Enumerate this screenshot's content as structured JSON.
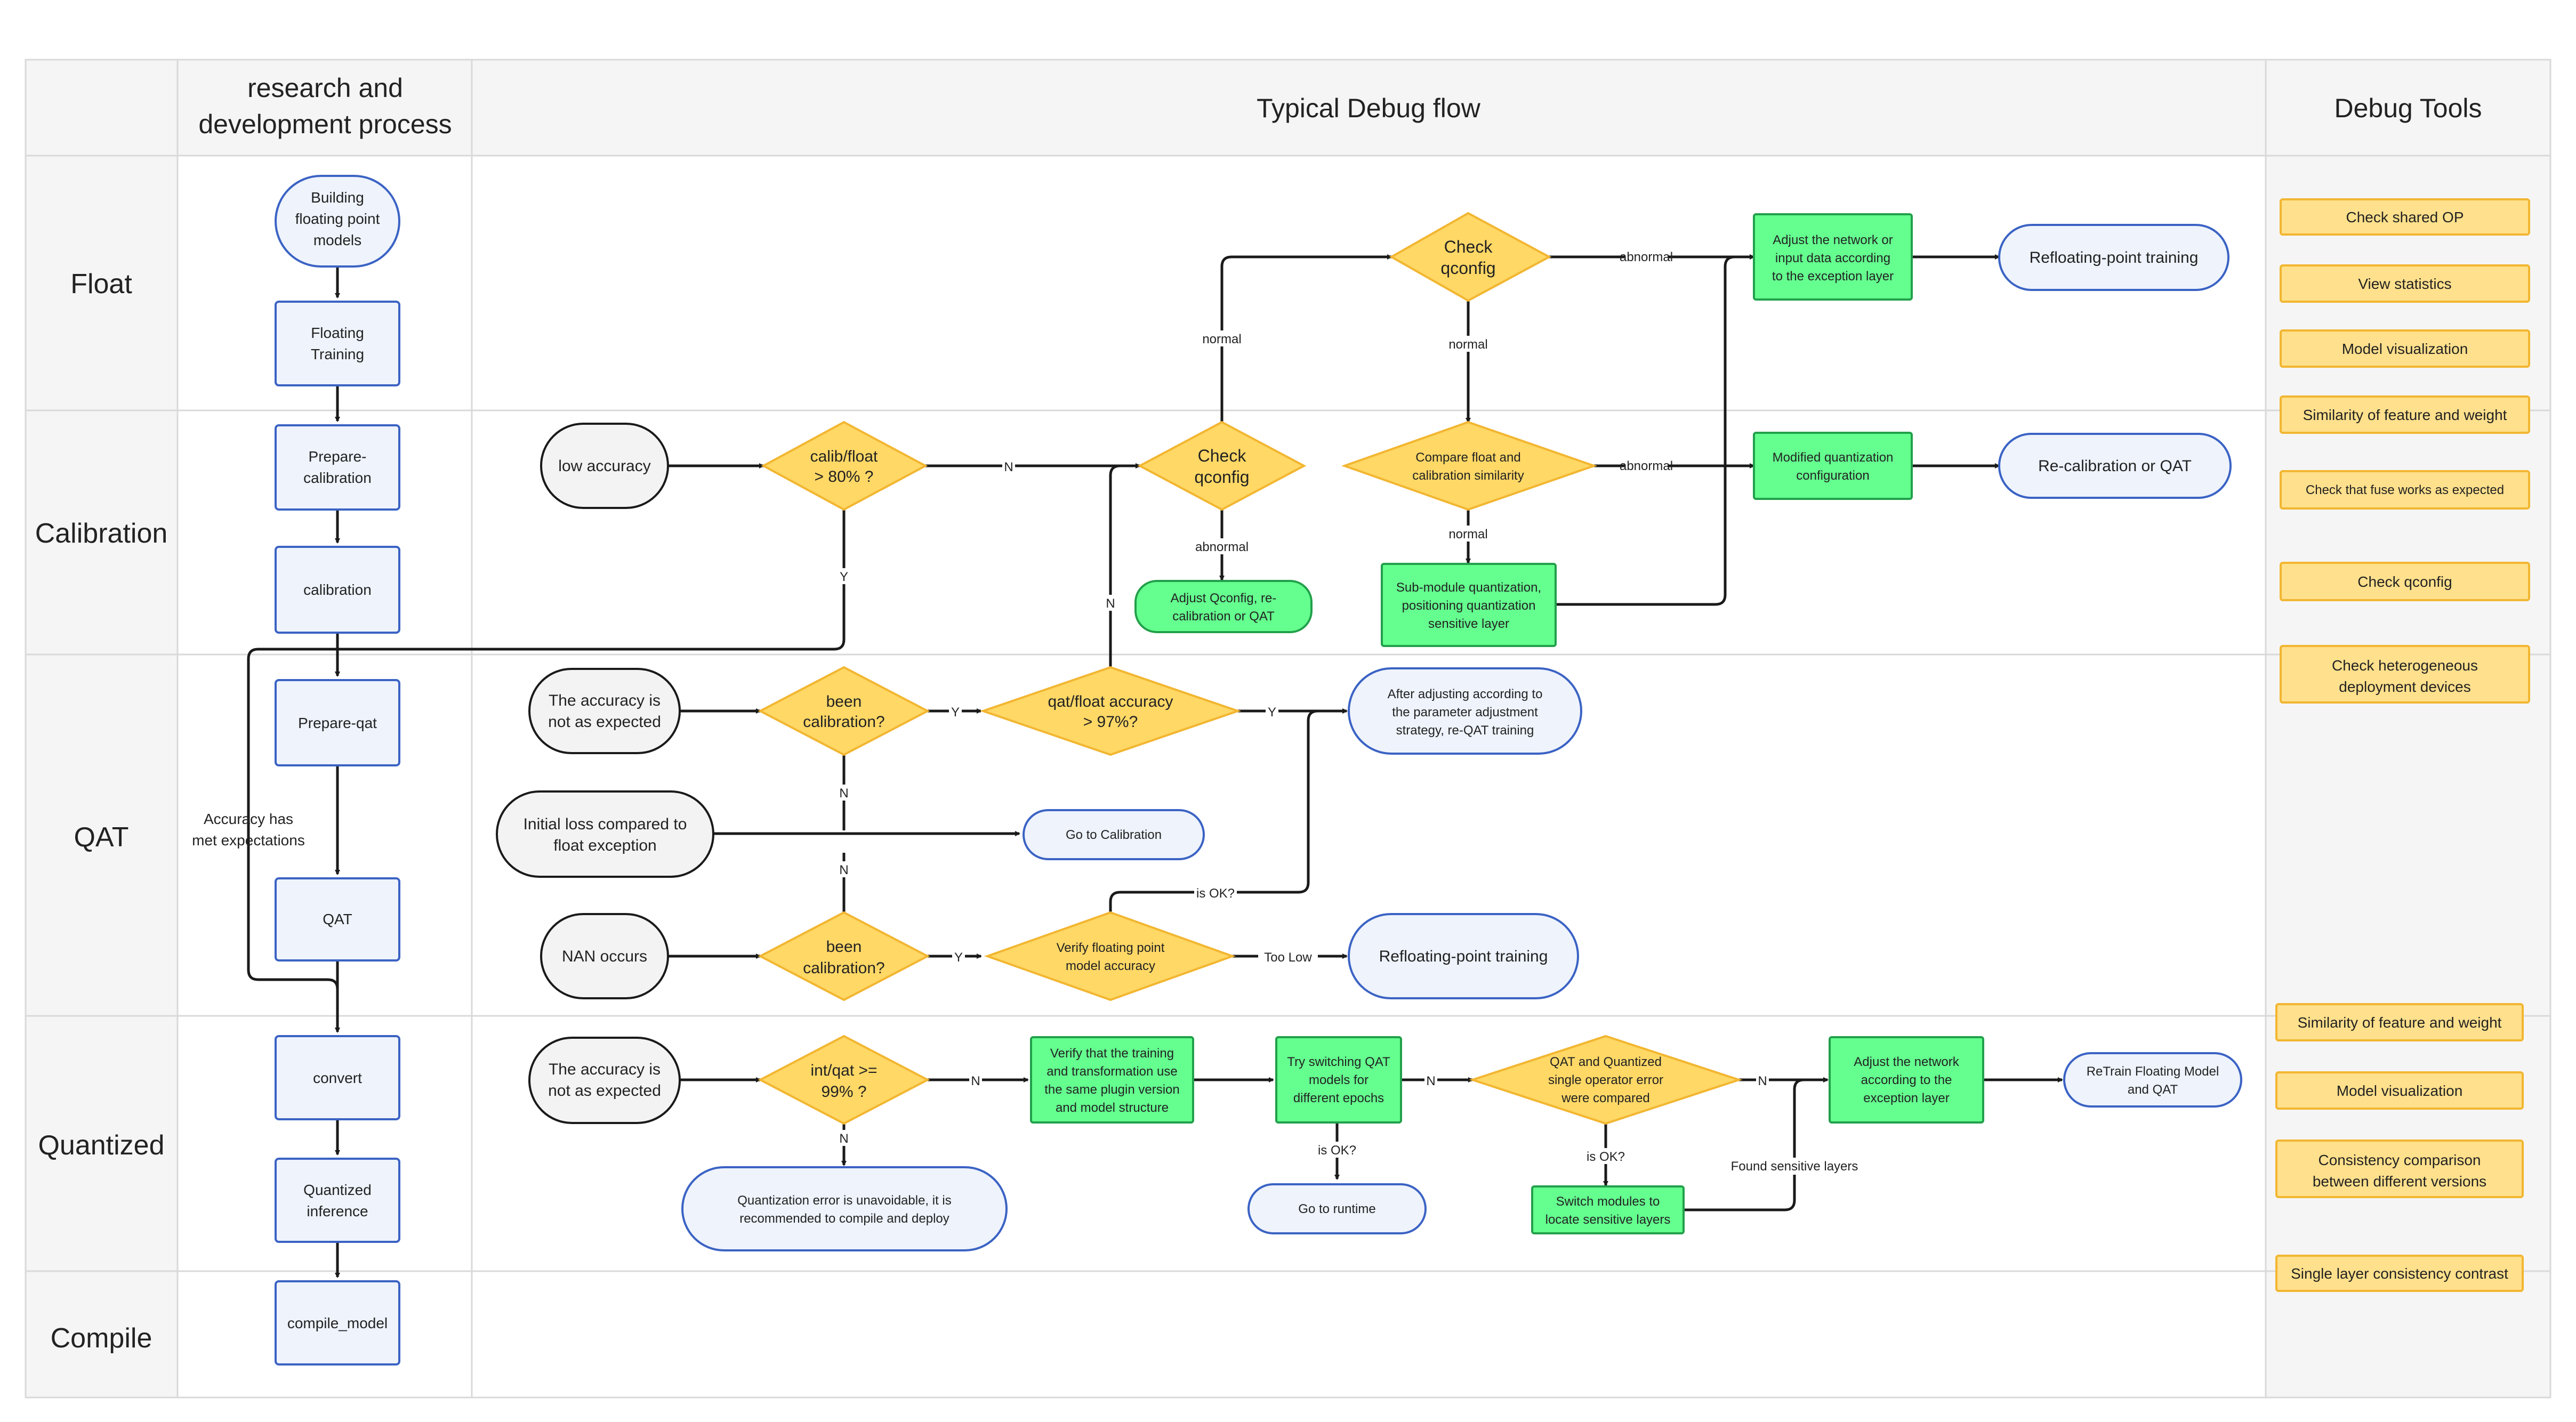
{
  "headers": {
    "process": [
      "research and",
      "development process"
    ],
    "flow": "Typical Debug flow",
    "tools": "Debug Tools"
  },
  "rows": [
    "Float",
    "Calibration",
    "QAT",
    "Quantized",
    "Compile"
  ],
  "process_steps": {
    "building": [
      "Building",
      "floating point",
      "models"
    ],
    "floating_training": [
      "Floating",
      "Training"
    ],
    "prepare_calibration": [
      "Prepare-",
      "calibration"
    ],
    "calibration": "calibration",
    "prepare_qat": "Prepare-qat",
    "qat": "QAT",
    "convert": "convert",
    "quantized_inference": [
      "Quantized",
      "inference"
    ],
    "compile_model": "compile_model"
  },
  "accuracy_met": [
    "Accuracy has",
    "met expectations"
  ],
  "calibration_flow": {
    "low_accuracy": "low accuracy",
    "calib_float": [
      "calib/float",
      "> 80% ?"
    ],
    "check_qconfig_cal": [
      "Check",
      "qconfig"
    ],
    "adjust_qconfig": [
      "Adjust Qconfig, re-",
      "calibration or QAT"
    ],
    "check_qconfig_top": [
      "Check",
      "qconfig"
    ],
    "adjust_network_top": [
      "Adjust the network or",
      "input data according",
      "to the exception layer"
    ],
    "refloat_top": "Refloating-point training",
    "compare_similarity": [
      "Compare float and",
      "calibration similarity"
    ],
    "modified_config": [
      "Modified quantization",
      "configuration"
    ],
    "recal_or_qat": "Re-calibration or QAT",
    "submodule": [
      "Sub-module quantization,",
      "positioning quantization",
      "sensitive layer"
    ]
  },
  "qat_flow": {
    "acc_not_expected": [
      "The accuracy is",
      "not as expected"
    ],
    "been_calib_1": [
      "been",
      "calibration?"
    ],
    "qat_float": [
      "qat/float accuracy",
      "> 97%?"
    ],
    "after_adjusting": [
      "After adjusting according to",
      "the parameter adjustment",
      "strategy, re-QAT training"
    ],
    "initial_loss": [
      "Initial loss compared to",
      "float exception"
    ],
    "go_calibration": "Go to Calibration",
    "nan_occurs": "NAN occurs",
    "been_calib_2": [
      "been",
      "calibration?"
    ],
    "verify_float": [
      "Verify floating point",
      "model accuracy"
    ],
    "refloat_qat": "Refloating-point training"
  },
  "quant_flow": {
    "acc_not_expected": [
      "The accuracy is",
      "not as expected"
    ],
    "int_qat": [
      "int/qat >=",
      "99% ?"
    ],
    "quant_error": [
      "Quantization error is unavoidable, it is",
      "recommended to compile and deploy"
    ],
    "verify_training": [
      "Verify that the training",
      "and transformation use",
      "the same plugin version",
      "and model structure"
    ],
    "try_switching": [
      "Try switching QAT",
      "models for",
      "different epochs"
    ],
    "go_runtime": "Go to runtime",
    "qat_quantized": [
      "QAT and Quantized",
      "single operator error",
      "were compared"
    ],
    "switch_modules": [
      "Switch modules to",
      "locate sensitive layers"
    ],
    "adjust_network": [
      "Adjust the network",
      "according to the",
      "exception layer"
    ],
    "retrain": [
      "ReTrain Floating Model",
      "and QAT"
    ]
  },
  "edge_labels": {
    "abnormal": "abnormal",
    "normal": "normal",
    "N": "N",
    "Y": "Y",
    "is_ok": "is OK?",
    "too_low": "Too Low",
    "found_sensitive": "Found sensitive layers"
  },
  "tools": [
    "Check shared OP",
    "View statistics",
    "Model visualization",
    "Similarity of feature and weight",
    "Check that fuse works as expected",
    "Check qconfig",
    "Check heterogeneous",
    "deployment devices",
    "Similarity of feature and weight",
    "Model visualization",
    "Consistency comparison",
    "between different versions",
    "Single layer consistency contrast"
  ],
  "colors": {
    "blue_fill": "#eef3fc",
    "blue_stroke": "#3b63c4",
    "gray_fill": "#f3f3f3",
    "yellow_fill": "#ffd866",
    "yellow_stroke": "#f2b631",
    "green_fill": "#64ff8f",
    "green_stroke": "#22a04a",
    "tool_fill": "#ffe08c",
    "tool_stroke": "#f2b631"
  }
}
